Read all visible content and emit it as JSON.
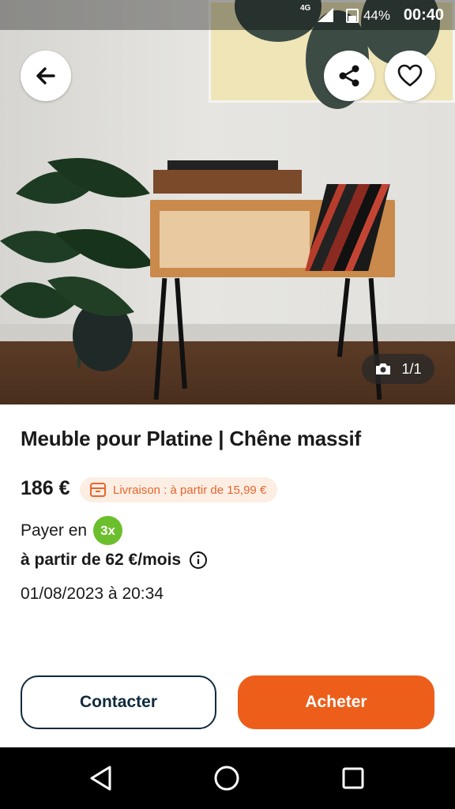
{
  "status_bar": {
    "network": "4G",
    "battery": "44%",
    "time": "00:40"
  },
  "gallery": {
    "counter": "1/1"
  },
  "product": {
    "title": "Meuble pour Platine | Chêne massif",
    "price": "186 €",
    "delivery": "Livraison : à partir de 15,99 €",
    "pay_in_label": "Payer en",
    "pay_in_badge": "3x",
    "monthly": "à partir de 62 €/mois",
    "date": "01/08/2023 à 20:34"
  },
  "actions": {
    "contact": "Contacter",
    "buy": "Acheter"
  },
  "colors": {
    "accent": "#ec5e1a",
    "badge_green": "#6bbf2c",
    "navy": "#0f2a3d"
  },
  "icons": [
    "back-arrow-icon",
    "share-icon",
    "heart-icon",
    "camera-icon",
    "package-icon",
    "info-icon",
    "nav-back-icon",
    "nav-home-icon",
    "nav-recents-icon"
  ]
}
